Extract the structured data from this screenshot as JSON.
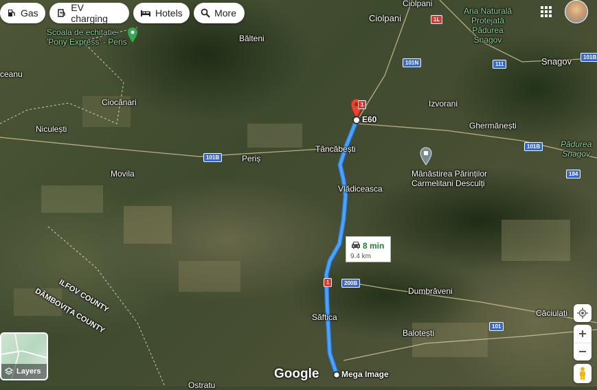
{
  "chips": [
    {
      "label": "Gas",
      "icon": "gas-station-icon"
    },
    {
      "label": "EV charging",
      "icon": "ev-charging-icon"
    },
    {
      "label": "Hotels",
      "icon": "hotel-bed-icon"
    },
    {
      "label": "More",
      "icon": "search-icon"
    }
  ],
  "places": {
    "ciolpani_top": "Ciolpani",
    "ciolpani": "Ciolpani",
    "arie_l1": "Aria Naturală",
    "arie_l2": "Protejată",
    "arie_l3": "Pădurea",
    "arie_l4": "Snagov",
    "scoala_l1": "Scoala de echitatie",
    "scoala_l2": "'Pony Express' - Peris",
    "balteni": "Bălteni",
    "snagov": "Snagov",
    "ceanu": "ceanu",
    "ciocanari": "Ciocănari",
    "izvorani": "Izvorani",
    "niculesti": "Niculești",
    "ghermanesti": "Ghermănești",
    "e60": "E60",
    "tancabesti": "Tâncăbești",
    "padurea_l1": "Pădurea",
    "padurea_l2": "Snagov",
    "peris": "Periș",
    "movila": "Movila",
    "manastirea_l1": "Mânăstirea Părinților",
    "manastirea_l2": "Carmelitani Desculți",
    "vladiceasca": "Vlădiceasca",
    "ilfov": "ILFOV COUNTY",
    "dambovita": "DÂMBOVIȚA COUNTY",
    "dumbraveni": "Dumbrăveni",
    "saftica": "Săftica",
    "caciulati": "Căciulați",
    "balotesti": "Balotești",
    "mega_image": "Mega Image",
    "ostratu": "Ostratu"
  },
  "shields": {
    "s1L": "1L",
    "s101N": "101N",
    "s111": "111",
    "s101B_r": "101B",
    "s1_top": "1",
    "s101B_l": "101B",
    "s101B_m": "101B",
    "s184": "184",
    "s1_mid": "1",
    "s200B": "200B",
    "s101": "101"
  },
  "route": {
    "time": "8 min",
    "distance": "9.4 km",
    "color": "#4aa3f5"
  },
  "brand": "Google",
  "layers": {
    "label": "Layers"
  }
}
